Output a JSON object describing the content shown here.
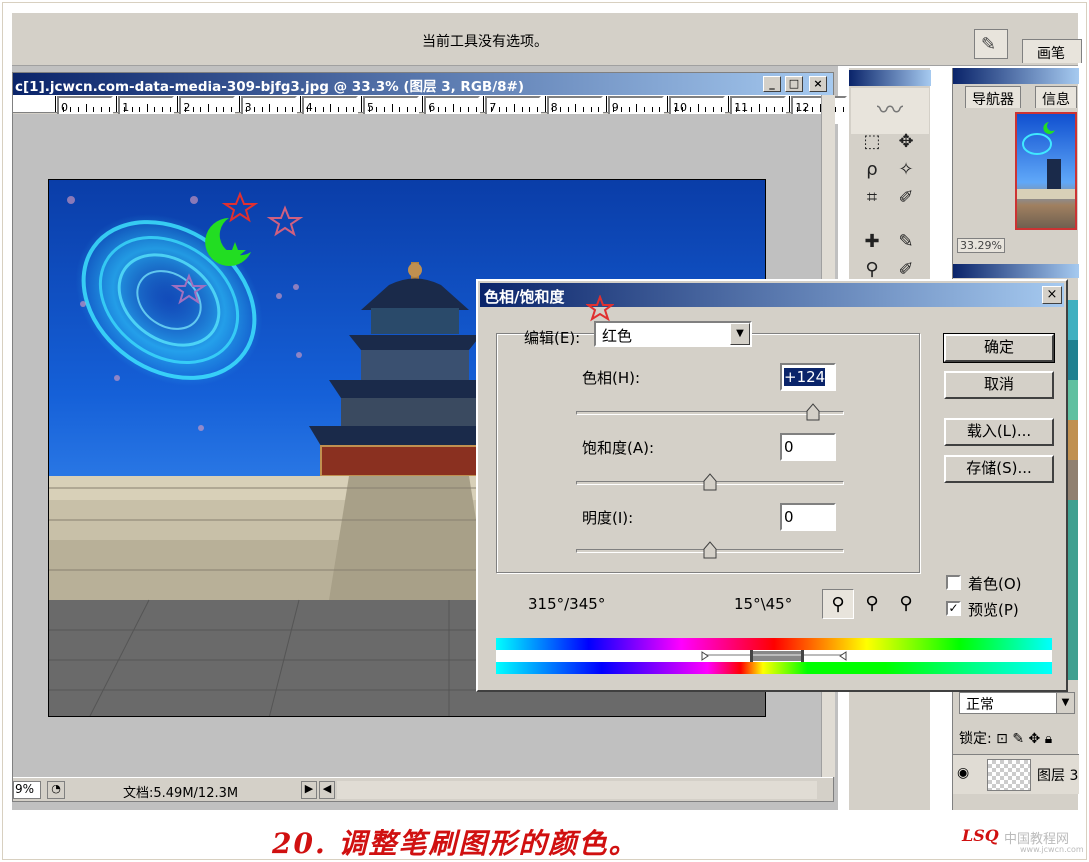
{
  "options_bar": {
    "message": "当前工具没有选项。",
    "brush_tab": "画笔"
  },
  "document": {
    "title": "c[1].jcwcn.com-data-media-309-bjfg3.jpg @ 33.3% (图层 3, RGB/8#)",
    "ruler_numbers": [
      "0",
      "1",
      "2",
      "3",
      "4",
      "5",
      "6",
      "7",
      "8",
      "9",
      "10",
      "11",
      "12"
    ],
    "zoom": "9%",
    "doc_info": "文档:5.49M/12.3M",
    "minimize": "_",
    "maximize": "□",
    "close": "×"
  },
  "navigator": {
    "tabs": [
      "导航器",
      "信息"
    ],
    "zoom": "33.29%"
  },
  "layers": {
    "blend_mode": "正常",
    "lock_label": "锁定:",
    "layer_name": "图层 3"
  },
  "dialog": {
    "title": "色相/饱和度",
    "close": "×",
    "edit_label": "编辑(E):",
    "edit_value": "红色",
    "hue_label": "色相(H):",
    "hue_value": "+124",
    "saturation_label": "饱和度(A):",
    "saturation_value": "0",
    "lightness_label": "明度(I):",
    "lightness_value": "0",
    "range_left": "315°/345°",
    "range_right": "15°\\45°",
    "ok": "确定",
    "cancel": "取消",
    "load": "载入(L)...",
    "save": "存储(S)...",
    "colorize": "着色(O)",
    "preview": "预览(P)",
    "preview_checked": "✓",
    "colorize_checked": "",
    "hue_slider": 0.888,
    "saturation_slider": 0.5,
    "lightness_slider": 0.5
  },
  "caption": "20. 调整笔刷图形的颜色。",
  "logo": "LSQ",
  "site": "中国教程网",
  "site_url": "www.jcwcn.com",
  "colors": {
    "titlebar": "#0a246a",
    "caption": "#d01010"
  }
}
